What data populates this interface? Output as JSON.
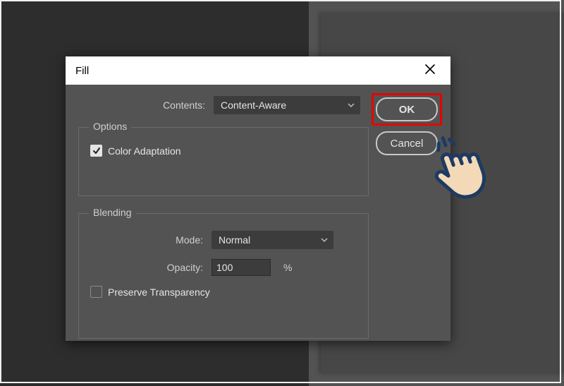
{
  "dialog": {
    "title": "Fill",
    "contents_label": "Contents:",
    "contents_value": "Content-Aware",
    "ok_label": "OK",
    "cancel_label": "Cancel",
    "options": {
      "group_title": "Options",
      "color_adaptation_label": "Color Adaptation"
    },
    "blending": {
      "group_title": "Blending",
      "mode_label": "Mode:",
      "mode_value": "Normal",
      "opacity_label": "Opacity:",
      "opacity_value": "100",
      "opacity_unit": "%",
      "preserve_label": "Preserve Transparency"
    }
  }
}
